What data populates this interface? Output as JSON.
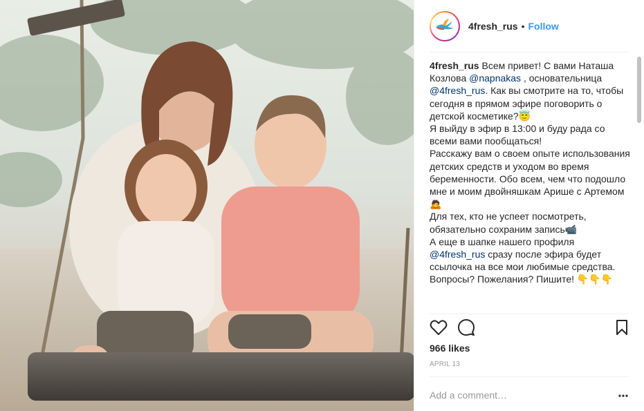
{
  "photo": {
    "description_icon": "family-photo"
  },
  "header": {
    "username": "4fresh_rus",
    "dot": "•",
    "follow_label": "Follow",
    "avatar_icon": "hummingbird-logo"
  },
  "caption": {
    "username": "4fresh_rus",
    "lines": [
      {
        "parts": [
          {
            "t": "Всем привет! С вами Наташа Козлова "
          },
          {
            "t": "@napnakas",
            "m": true
          },
          {
            "t": " , основательница "
          },
          {
            "t": "@4fresh_rus",
            "m": true
          },
          {
            "t": ". Как вы смотрите на то, чтобы сегодня в прямом эфире поговорить о детской косметике?😇"
          }
        ]
      },
      {
        "parts": [
          {
            "t": "Я выйду в эфир в 13:00 и буду рада со всеми вами пообщаться!"
          }
        ]
      },
      {
        "parts": [
          {
            "t": "Расскажу вам о своем опыте использования детских средств и уходом во время беременности. Обо всем, чем что подошло мне и моим двойняшкам Арише с Артемом🙇"
          }
        ]
      },
      {
        "parts": [
          {
            "t": "Для тех, кто не успеет посмотреть, обязательно сохраним запись📹"
          }
        ]
      },
      {
        "parts": [
          {
            "t": "А еще в шапке нашего профиля "
          },
          {
            "t": "@4fresh_rus",
            "m": true
          },
          {
            "t": " сразу после эфира будет ссылочка на все мои любимые средства."
          }
        ]
      },
      {
        "parts": [
          {
            "t": "Вопросы? Пожелания? Пишите! 👇👇👇"
          }
        ]
      }
    ]
  },
  "actions": {
    "like_icon": "heart-icon",
    "comment_icon": "comment-icon",
    "save_icon": "bookmark-icon"
  },
  "likes": "966 likes",
  "date": "APRIL 13",
  "comment": {
    "placeholder": "Add a comment…"
  },
  "colors": {
    "link": "#3897f0",
    "mention": "#003569",
    "muted": "#999999",
    "divider": "#efefef"
  }
}
